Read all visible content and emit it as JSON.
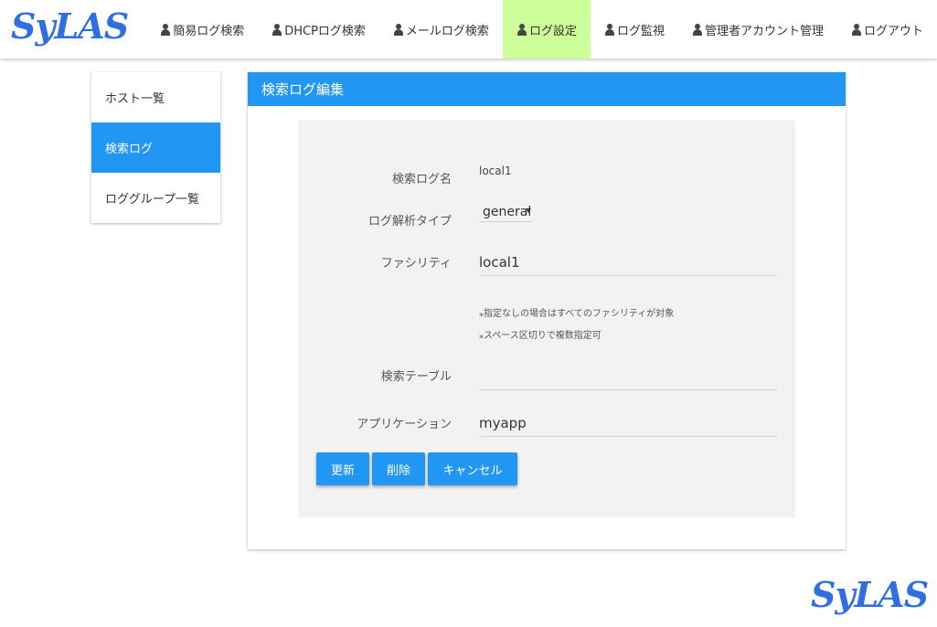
{
  "brand": {
    "logo_text": "SyLAS",
    "logo_color": "#2f6fe0"
  },
  "nav": {
    "items": [
      {
        "label": "簡易ログ検索",
        "icon": "person-icon"
      },
      {
        "label": "DHCPログ検索",
        "icon": "person-icon"
      },
      {
        "label": "メールログ検索",
        "icon": "person-icon"
      },
      {
        "label": "ログ設定",
        "icon": "person-icon",
        "active": true
      },
      {
        "label": "ログ監視",
        "icon": "person-icon"
      },
      {
        "label": "管理者アカウント管理",
        "icon": "person-icon"
      },
      {
        "label": "ログアウト",
        "icon": "person-icon"
      }
    ],
    "active_color": "#ccff99"
  },
  "sidebar": {
    "items": [
      {
        "label": "ホスト一覧"
      },
      {
        "label": "検索ログ",
        "active": true
      },
      {
        "label": "ロググループ一覧"
      }
    ],
    "active_color": "#2196f3"
  },
  "card": {
    "title": "検索ログ編集",
    "header_color": "#2196f3"
  },
  "form": {
    "name_label": "検索ログ名",
    "name_value": "local1",
    "type_label": "ログ解析タイプ",
    "type_value": "general",
    "facility_label": "ファシリティ",
    "facility_value": "local1",
    "note_1": "⁎指定なしの場合はすべてのファシリティが対象",
    "note_2": "⁎スペース区切りで複数指定可",
    "table_label": "検索テーブル",
    "table_value": "",
    "app_label": "アプリケーション",
    "app_value": "myapp"
  },
  "buttons": {
    "update": "更新",
    "delete": "削除",
    "cancel": "キャンセル"
  },
  "footer": {
    "logo_text": "SyLAS"
  }
}
